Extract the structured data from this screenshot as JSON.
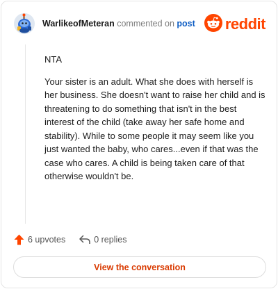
{
  "header": {
    "username": "WarlikeofMeteran",
    "action_text": "commented on",
    "post_link_text": "post",
    "avatar_icon": "snoo-avatar-icon",
    "logo_icon": "reddit-snoo-icon",
    "logo_text": "reddit"
  },
  "comment": {
    "paragraphs": [
      "NTA",
      "Your sister is an adult. What she does with herself is her business. She doesn't want to raise her child and is threatening to do something that isn't in the best interest of the child (take away her safe home and stability). While to some people it may seem like you just wanted the baby, who cares...even if that was the case who cares. A child is being taken care of that otherwise wouldn't be."
    ]
  },
  "meta": {
    "upvotes_label": "6 upvotes",
    "replies_label": "0 replies",
    "upvote_icon": "upvote-arrow-icon",
    "reply_icon": "reply-arrow-icon"
  },
  "cta": {
    "label": "View the conversation"
  },
  "colors": {
    "brand": "#ff4500",
    "link": "#0f5ec4",
    "cta_text": "#d93a00",
    "border": "#e4e4e4"
  }
}
